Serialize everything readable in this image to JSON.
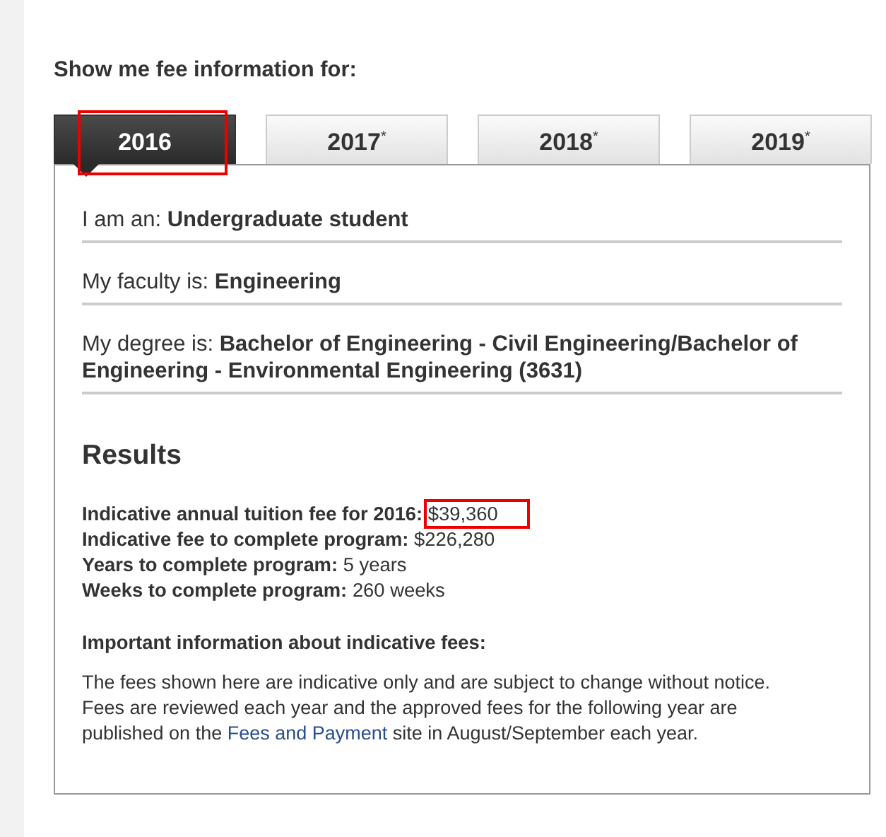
{
  "heading": "Show me fee information for:",
  "tabs": [
    {
      "label": "2016",
      "selected": true,
      "annotated": true
    },
    {
      "label": "2017$^{*}$",
      "selected": false,
      "annotated": false
    },
    {
      "label": "2018$^{*}$",
      "selected": false,
      "annotated": false
    },
    {
      "label": "2019$^{*}$",
      "selected": false,
      "annotated": false
    }
  ],
  "selections": [
    {
      "label": "I am an:",
      "value": "Undergraduate student"
    },
    {
      "label": "My faculty is:",
      "value": "Engineering"
    },
    {
      "label": "My degree is:",
      "value": "Bachelor of Engineering - Civil Engineering/Bachelor of Engineering - Environmental Engineering (3631)"
    }
  ],
  "results": {
    "title": "Results",
    "items": [
      {
        "label": "Indicative annual tuition fee for 2016:",
        "value": "$39,360",
        "annotated": true
      },
      {
        "label": "Indicative fee to complete program:",
        "value": "$226,280",
        "annotated": false
      },
      {
        "label": "Years to complete program:",
        "value": "5 years",
        "annotated": false
      },
      {
        "label": "Weeks to complete program:",
        "value": "260 weeks",
        "annotated": false
      }
    ]
  },
  "notice": {
    "title": "Important information about indicative fees:",
    "text_before": "The fees shown here are indicative only and are subject to change without notice. Fees are reviewed each year and the approved fees for the following year are published on the",
    "link": "Fees and Payment",
    "text_after": "site in August/September each year."
  }
}
